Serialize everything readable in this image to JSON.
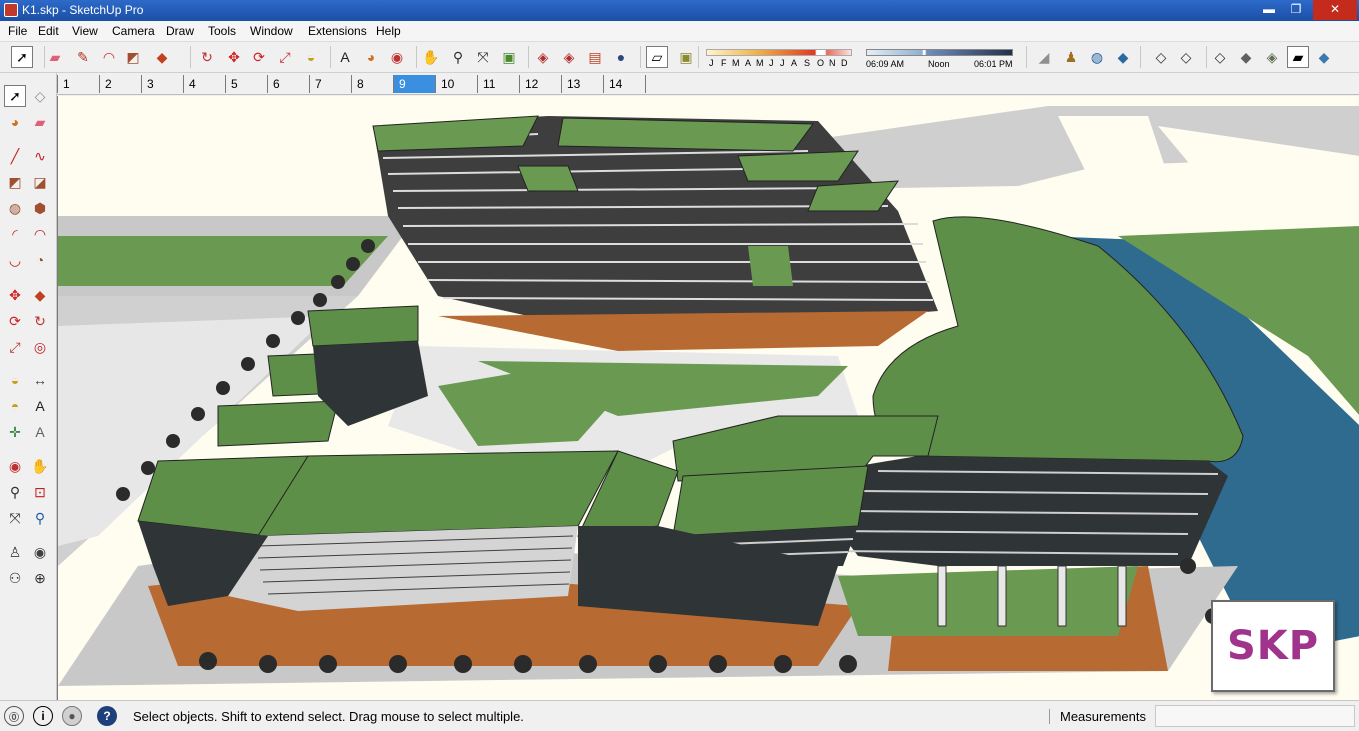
{
  "window": {
    "title": "K1.skp - SketchUp Pro",
    "minimize_glyph": "▬",
    "maximize_glyph": "❐",
    "close_glyph": "✕"
  },
  "menu": [
    "File",
    "Edit",
    "View",
    "Camera",
    "Draw",
    "Tools",
    "Window",
    "Extensions",
    "Help"
  ],
  "toolbar": {
    "tools": [
      {
        "name": "select-tool-icon",
        "glyph": "➚",
        "color": "#000000",
        "active": true
      },
      {
        "name": "eraser-tool-icon",
        "glyph": "▰",
        "color": "#e0607a"
      },
      {
        "name": "line-tool-icon",
        "glyph": "✎",
        "color": "#b03020"
      },
      {
        "name": "arc-tool-icon",
        "glyph": "◠",
        "color": "#c03030"
      },
      {
        "name": "rectangle-tool-icon",
        "glyph": "◩",
        "color": "#a05030"
      },
      {
        "name": "push-pull-tool-icon",
        "glyph": "◆",
        "color": "#c04020"
      },
      {
        "name": "follow-me-tool-icon",
        "glyph": "↻",
        "color": "#c03030"
      },
      {
        "name": "move-tool-icon",
        "glyph": "✥",
        "color": "#d02020"
      },
      {
        "name": "rotate-tool-icon",
        "glyph": "⟳",
        "color": "#d02020"
      },
      {
        "name": "scale-tool-icon",
        "glyph": "⤢",
        "color": "#c03030"
      },
      {
        "name": "tape-measure-tool-icon",
        "glyph": "◒",
        "color": "#c8a020"
      },
      {
        "name": "text-tool-icon",
        "glyph": "A",
        "color": "#202020"
      },
      {
        "name": "paint-bucket-tool-icon",
        "glyph": "◕",
        "color": "#d07020"
      },
      {
        "name": "orbit-tool-icon",
        "glyph": "◉",
        "color": "#c03030"
      },
      {
        "name": "pan-tool-icon",
        "glyph": "✋",
        "color": "#404040"
      },
      {
        "name": "zoom-tool-icon",
        "glyph": "⚲",
        "color": "#303030"
      },
      {
        "name": "zoom-extents-tool-icon",
        "glyph": "⤧",
        "color": "#303030"
      },
      {
        "name": "add-location-icon",
        "glyph": "▣",
        "color": "#4a8a30"
      },
      {
        "name": "get-models-icon",
        "glyph": "◈",
        "color": "#b03030"
      },
      {
        "name": "share-model-icon",
        "glyph": "◈",
        "color": "#b03030"
      },
      {
        "name": "extension-warehouse-icon",
        "glyph": "▤",
        "color": "#c04020"
      },
      {
        "name": "shadows-toggle-icon",
        "glyph": "●",
        "color": "#2a4a7a"
      },
      {
        "name": "display-shadows-icon",
        "glyph": "▱",
        "color": "#000000",
        "active": true
      },
      {
        "name": "geo-location-icon",
        "glyph": "▣",
        "color": "#8a8a30"
      },
      {
        "name": "photo-textures-icon",
        "glyph": "◢",
        "color": "#909090"
      },
      {
        "name": "figure-icon",
        "glyph": "♟",
        "color": "#a07020"
      },
      {
        "name": "globe-icon",
        "glyph": "◍",
        "color": "#2060a0"
      },
      {
        "name": "iso-view-icon",
        "glyph": "◆",
        "color": "#2a6aa0"
      },
      {
        "name": "top-view-icon",
        "glyph": "◇",
        "color": "#303030"
      },
      {
        "name": "front-view-icon",
        "glyph": "◇",
        "color": "#303030"
      },
      {
        "name": "right-view-icon",
        "glyph": "◇",
        "color": "#303030"
      },
      {
        "name": "back-view-icon",
        "glyph": "◆",
        "color": "#606060"
      },
      {
        "name": "xray-style-icon",
        "glyph": "◈",
        "color": "#607050"
      },
      {
        "name": "shaded-style-icon",
        "glyph": "▰",
        "color": "#000000",
        "active": true
      },
      {
        "name": "textured-style-icon",
        "glyph": "◆",
        "color": "#3a7ab0"
      }
    ],
    "months": [
      "J",
      "F",
      "M",
      "A",
      "M",
      "J",
      "J",
      "A",
      "S",
      "O",
      "N",
      "D"
    ],
    "time_start": "06:09 AM",
    "time_mid": "Noon",
    "time_end": "06:01 PM"
  },
  "scenes": [
    "1",
    "2",
    "3",
    "4",
    "5",
    "6",
    "7",
    "8",
    "9",
    "10",
    "11",
    "12",
    "13",
    "14"
  ],
  "active_scene": "9",
  "left_tools": [
    {
      "name": "select-icon",
      "glyph": "➚",
      "color": "#000000",
      "active": true
    },
    {
      "name": "make-component-icon",
      "glyph": "◇",
      "color": "#909090"
    },
    {
      "name": "paint-bucket-icon",
      "glyph": "◕",
      "color": "#d07020"
    },
    {
      "name": "eraser-icon",
      "glyph": "▰",
      "color": "#e0607a"
    },
    {
      "name": "line-icon",
      "glyph": "╱",
      "color": "#c02020"
    },
    {
      "name": "freehand-icon",
      "glyph": "∿",
      "color": "#c02020"
    },
    {
      "name": "rectangle-icon",
      "glyph": "◩",
      "color": "#a05030"
    },
    {
      "name": "rotated-rectangle-icon",
      "glyph": "◪",
      "color": "#a05030"
    },
    {
      "name": "circle-icon",
      "glyph": "◍",
      "color": "#a05030"
    },
    {
      "name": "polygon-icon",
      "glyph": "⬢",
      "color": "#a05030"
    },
    {
      "name": "arc-icon",
      "glyph": "◜",
      "color": "#c02020"
    },
    {
      "name": "two-point-arc-icon",
      "glyph": "◠",
      "color": "#c02020"
    },
    {
      "name": "three-point-arc-icon",
      "glyph": "◡",
      "color": "#c02020"
    },
    {
      "name": "pie-icon",
      "glyph": "◔",
      "color": "#a05030"
    },
    {
      "name": "move-icon",
      "glyph": "✥",
      "color": "#d02020"
    },
    {
      "name": "push-pull-icon",
      "glyph": "◆",
      "color": "#c04020"
    },
    {
      "name": "rotate-icon",
      "glyph": "⟳",
      "color": "#d02020"
    },
    {
      "name": "follow-me-icon",
      "glyph": "↻",
      "color": "#c03030"
    },
    {
      "name": "scale-icon",
      "glyph": "⤢",
      "color": "#c03030"
    },
    {
      "name": "offset-icon",
      "glyph": "◎",
      "color": "#c02020"
    },
    {
      "name": "tape-measure-icon",
      "glyph": "◒",
      "color": "#c8a020"
    },
    {
      "name": "dimension-icon",
      "glyph": "↔",
      "color": "#404040"
    },
    {
      "name": "protractor-icon",
      "glyph": "◓",
      "color": "#c8a020"
    },
    {
      "name": "text-icon",
      "glyph": "A",
      "color": "#202020"
    },
    {
      "name": "axes-icon",
      "glyph": "✛",
      "color": "#2a7a30"
    },
    {
      "name": "3d-text-icon",
      "glyph": "A",
      "color": "#606060"
    },
    {
      "name": "orbit-icon",
      "glyph": "◉",
      "color": "#c03030"
    },
    {
      "name": "pan-icon",
      "glyph": "✋",
      "color": "#404040"
    },
    {
      "name": "zoom-icon",
      "glyph": "⚲",
      "color": "#303030"
    },
    {
      "name": "zoom-window-icon",
      "glyph": "⊡",
      "color": "#c02020"
    },
    {
      "name": "zoom-extents-icon",
      "glyph": "⤧",
      "color": "#303030"
    },
    {
      "name": "previous-view-icon",
      "glyph": "⚲",
      "color": "#2060a0"
    },
    {
      "name": "position-camera-icon",
      "glyph": "♙",
      "color": "#404040"
    },
    {
      "name": "look-around-icon",
      "glyph": "◉",
      "color": "#404040"
    },
    {
      "name": "walk-icon",
      "glyph": "⚇",
      "color": "#303030"
    },
    {
      "name": "section-plane-icon",
      "glyph": "⊕",
      "color": "#303030"
    }
  ],
  "watermark": "SKP",
  "status": {
    "message": "Select objects. Shift to extend select. Drag mouse to select multiple.",
    "measurements_label": "Measurements",
    "measurements_value": ""
  }
}
